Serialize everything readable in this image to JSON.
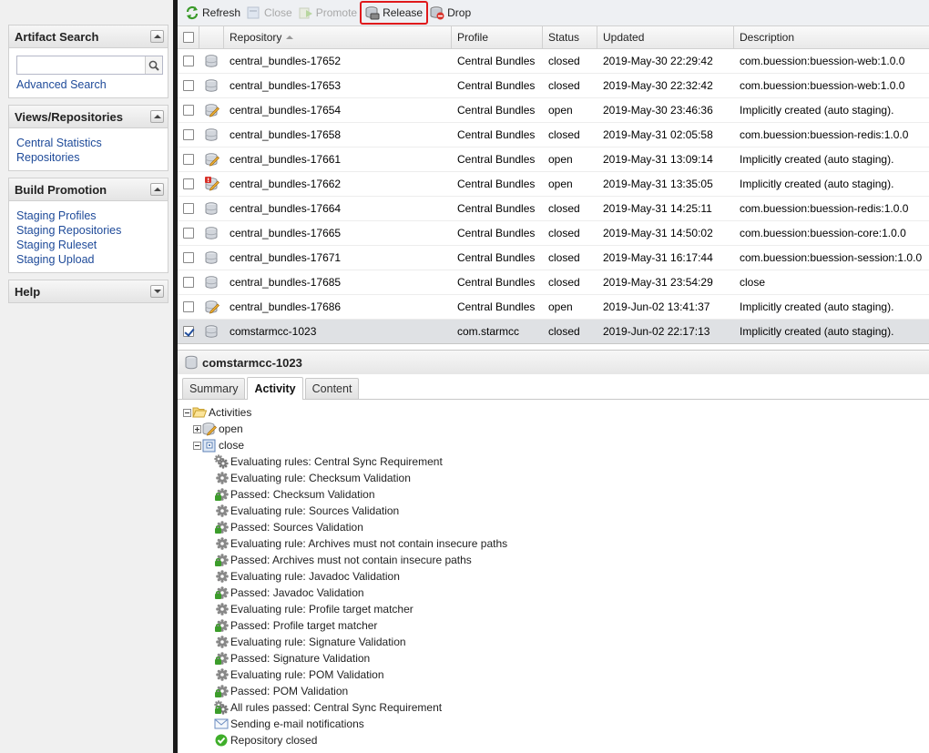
{
  "sidebar": {
    "artifact_search": {
      "title": "Artifact Search",
      "search_value": "",
      "advanced_link": "Advanced Search"
    },
    "views": {
      "title": "Views/Repositories",
      "items": [
        "Central Statistics",
        "Repositories"
      ]
    },
    "build_promotion": {
      "title": "Build Promotion",
      "items": [
        "Staging Profiles",
        "Staging Repositories",
        "Staging Ruleset",
        "Staging Upload"
      ]
    },
    "help": {
      "title": "Help"
    }
  },
  "toolbar": {
    "refresh": "Refresh",
    "close": "Close",
    "promote": "Promote",
    "release": "Release",
    "drop": "Drop"
  },
  "grid": {
    "columns": {
      "repository": "Repository",
      "profile": "Profile",
      "status": "Status",
      "updated": "Updated",
      "description": "Description"
    },
    "rows": [
      {
        "repository": "central_bundles-17652",
        "profile": "Central Bundles",
        "status": "closed",
        "updated": "2019-May-30 22:29:42",
        "description": "com.buession:buession-web:1.0.0",
        "icon": "repo-closed-icon",
        "checked": false
      },
      {
        "repository": "central_bundles-17653",
        "profile": "Central Bundles",
        "status": "closed",
        "updated": "2019-May-30 22:32:42",
        "description": "com.buession:buession-web:1.0.0",
        "icon": "repo-closed-icon",
        "checked": false
      },
      {
        "repository": "central_bundles-17654",
        "profile": "Central Bundles",
        "status": "open",
        "updated": "2019-May-30 23:46:36",
        "description": "Implicitly created (auto staging).",
        "icon": "repo-open-icon",
        "checked": false
      },
      {
        "repository": "central_bundles-17658",
        "profile": "Central Bundles",
        "status": "closed",
        "updated": "2019-May-31 02:05:58",
        "description": "com.buession:buession-redis:1.0.0",
        "icon": "repo-closed-icon",
        "checked": false
      },
      {
        "repository": "central_bundles-17661",
        "profile": "Central Bundles",
        "status": "open",
        "updated": "2019-May-31 13:09:14",
        "description": "Implicitly created (auto staging).",
        "icon": "repo-open-icon",
        "checked": false
      },
      {
        "repository": "central_bundles-17662",
        "profile": "Central Bundles",
        "status": "open",
        "updated": "2019-May-31 13:35:05",
        "description": "Implicitly created (auto staging).",
        "icon": "repo-open-error-icon",
        "checked": false
      },
      {
        "repository": "central_bundles-17664",
        "profile": "Central Bundles",
        "status": "closed",
        "updated": "2019-May-31 14:25:11",
        "description": "com.buession:buession-redis:1.0.0",
        "icon": "repo-closed-icon",
        "checked": false
      },
      {
        "repository": "central_bundles-17665",
        "profile": "Central Bundles",
        "status": "closed",
        "updated": "2019-May-31 14:50:02",
        "description": "com.buession:buession-core:1.0.0",
        "icon": "repo-closed-icon",
        "checked": false
      },
      {
        "repository": "central_bundles-17671",
        "profile": "Central Bundles",
        "status": "closed",
        "updated": "2019-May-31 16:17:44",
        "description": "com.buession:buession-session:1.0.0",
        "icon": "repo-closed-icon",
        "checked": false
      },
      {
        "repository": "central_bundles-17685",
        "profile": "Central Bundles",
        "status": "closed",
        "updated": "2019-May-31 23:54:29",
        "description": "close",
        "icon": "repo-closed-icon",
        "checked": false
      },
      {
        "repository": "central_bundles-17686",
        "profile": "Central Bundles",
        "status": "open",
        "updated": "2019-Jun-02 13:41:37",
        "description": "Implicitly created (auto staging).",
        "icon": "repo-open-icon",
        "checked": false
      },
      {
        "repository": "comstarmcc-1023",
        "profile": "com.starmcc",
        "status": "closed",
        "updated": "2019-Jun-02 22:17:13",
        "description": "Implicitly created (auto staging).",
        "icon": "repo-closed-icon",
        "checked": true
      }
    ]
  },
  "detail": {
    "title": "comstarmcc-1023",
    "tabs": [
      "Summary",
      "Activity",
      "Content"
    ],
    "active_tab": "Activity",
    "tree": {
      "root": "Activities",
      "open": "open",
      "close": "close",
      "events": [
        {
          "text": "Evaluating rules: Central Sync Requirement",
          "icon": "gears-icon"
        },
        {
          "text": "Evaluating rule: Checksum Validation",
          "icon": "gear-icon"
        },
        {
          "text": "Passed: Checksum Validation",
          "icon": "gear-passed-icon"
        },
        {
          "text": "Evaluating rule: Sources Validation",
          "icon": "gear-icon"
        },
        {
          "text": "Passed: Sources Validation",
          "icon": "gear-passed-icon"
        },
        {
          "text": "Evaluating rule: Archives must not contain insecure paths",
          "icon": "gear-icon"
        },
        {
          "text": "Passed: Archives must not contain insecure paths",
          "icon": "gear-passed-icon"
        },
        {
          "text": "Evaluating rule: Javadoc Validation",
          "icon": "gear-icon"
        },
        {
          "text": "Passed: Javadoc Validation",
          "icon": "gear-passed-icon"
        },
        {
          "text": "Evaluating rule: Profile target matcher",
          "icon": "gear-icon"
        },
        {
          "text": "Passed: Profile target matcher",
          "icon": "gear-passed-icon"
        },
        {
          "text": "Evaluating rule: Signature Validation",
          "icon": "gear-icon"
        },
        {
          "text": "Passed: Signature Validation",
          "icon": "gear-passed-icon"
        },
        {
          "text": "Evaluating rule: POM Validation",
          "icon": "gear-icon"
        },
        {
          "text": "Passed: POM Validation",
          "icon": "gear-passed-icon"
        },
        {
          "text": "All rules passed: Central Sync Requirement",
          "icon": "gears-passed-icon"
        },
        {
          "text": "Sending e-mail notifications",
          "icon": "email-icon"
        },
        {
          "text": "Repository closed",
          "icon": "check-circle-icon"
        }
      ]
    }
  },
  "colors": {
    "highlight": "#e0191b",
    "link": "#1e4a99",
    "selected_row": "#dfe1e4"
  }
}
